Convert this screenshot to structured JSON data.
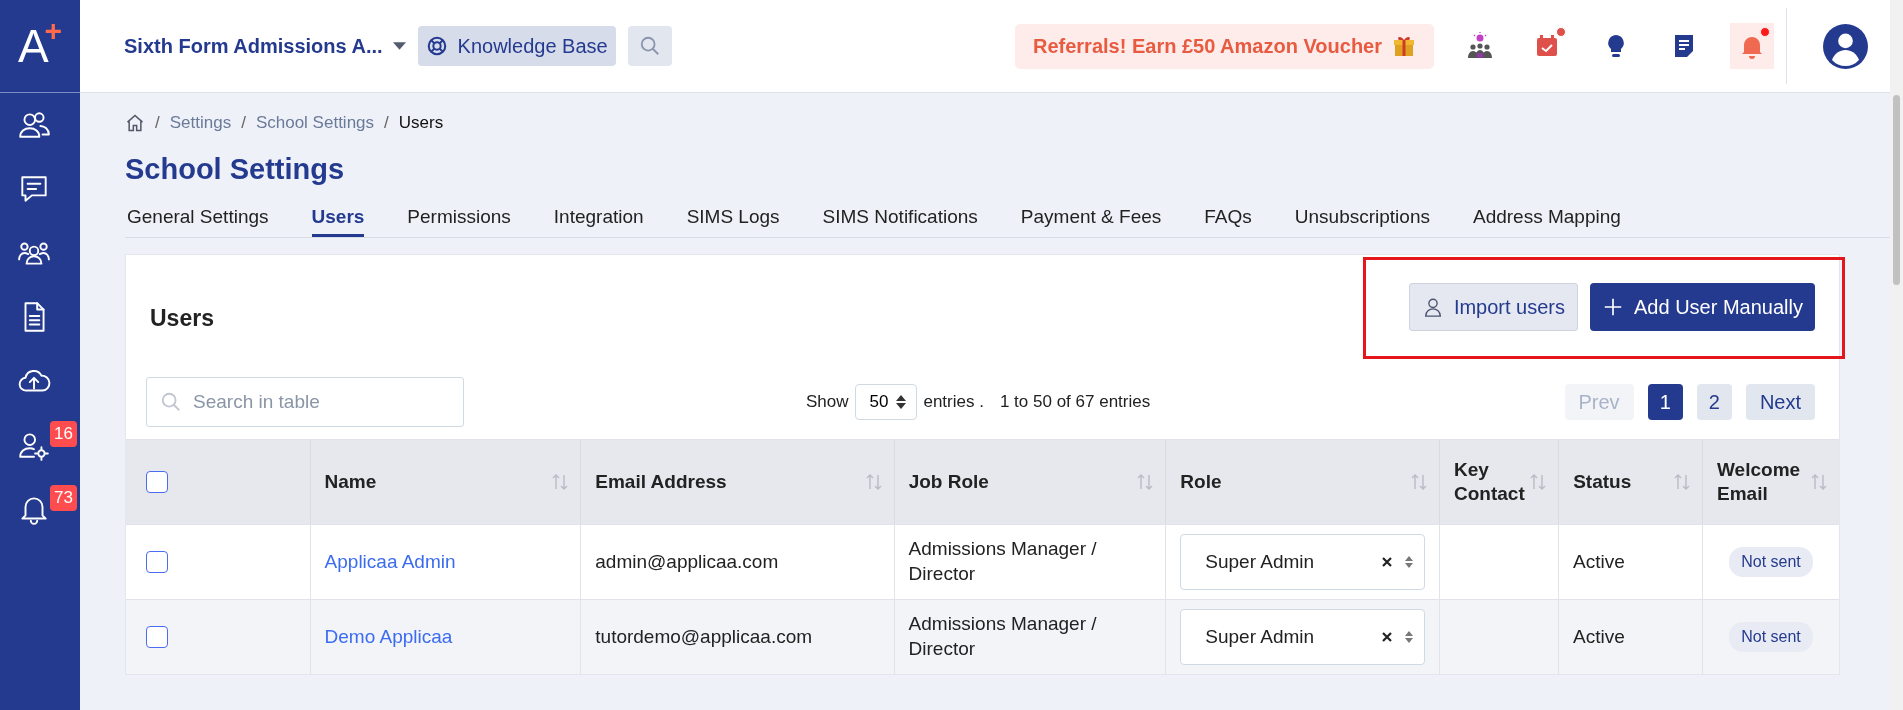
{
  "logo": {
    "letter": "A",
    "mark": "+"
  },
  "sidebar": {
    "items": [
      {
        "kind": "people"
      },
      {
        "kind": "chat"
      },
      {
        "kind": "group"
      },
      {
        "kind": "document"
      },
      {
        "kind": "cloud"
      },
      {
        "kind": "users-gear",
        "badge": "16"
      },
      {
        "kind": "bell",
        "badge": "73"
      }
    ]
  },
  "topbar": {
    "school": "Sixth Form Admissions A...",
    "knowledge_base": "Knowledge Base",
    "referral": "Referrals! Earn £50 Amazon Voucher",
    "icons": [
      {
        "kind": "team-idea",
        "alert": false
      },
      {
        "kind": "calendar",
        "alert": true
      },
      {
        "kind": "lightbulb",
        "alert": false
      },
      {
        "kind": "notes",
        "alert": false
      },
      {
        "kind": "bell",
        "alert": true
      }
    ]
  },
  "breadcrumb": [
    "Settings",
    "School Settings",
    "Users"
  ],
  "breadcrumb_separator": "/",
  "page_title": "School Settings",
  "tabs": [
    {
      "label": "General Settings",
      "selected": false
    },
    {
      "label": "Users",
      "selected": true
    },
    {
      "label": "Permissions",
      "selected": false
    },
    {
      "label": "Integration",
      "selected": false
    },
    {
      "label": "SIMS Logs",
      "selected": false
    },
    {
      "label": "SIMS Notifications",
      "selected": false
    },
    {
      "label": "Payment & Fees",
      "selected": false
    },
    {
      "label": "FAQs",
      "selected": false
    },
    {
      "label": "Unsubscriptions",
      "selected": false
    },
    {
      "label": "Address Mapping",
      "selected": false
    }
  ],
  "card": {
    "title": "Users",
    "import_button": "Import users",
    "add_button": "Add User Manually"
  },
  "search": {
    "placeholder": "Search in table"
  },
  "entries": {
    "show": "Show",
    "value": "50",
    "suffix": "entries .",
    "info": "1 to 50 of 67 entries"
  },
  "pagination": [
    {
      "label": "Prev",
      "kind": "nav",
      "disabled": true,
      "selected": false
    },
    {
      "label": "1",
      "kind": "page",
      "disabled": false,
      "selected": true
    },
    {
      "label": "2",
      "kind": "page",
      "disabled": false,
      "selected": false
    },
    {
      "label": "Next",
      "kind": "nav",
      "disabled": false,
      "selected": false
    }
  ],
  "table": {
    "select_all_checked": false,
    "columns": [
      "Name",
      "Email Address",
      "Job Role",
      "Role",
      "Key Contact",
      "Status",
      "Welcome Email"
    ],
    "rows": [
      {
        "checked": false,
        "name": "Applicaa Admin",
        "email": "admin@applicaa.com",
        "job_role": "Admissions Manager / Director",
        "role": "Super Admin",
        "status": "Active",
        "welcome_email": "Not sent"
      },
      {
        "checked": false,
        "name": "Demo Applicaa",
        "email": "tutordemo@applicaa.com",
        "job_role": "Admissions Manager / Director",
        "role": "Super Admin",
        "status": "Active",
        "welcome_email": "Not sent"
      }
    ]
  }
}
